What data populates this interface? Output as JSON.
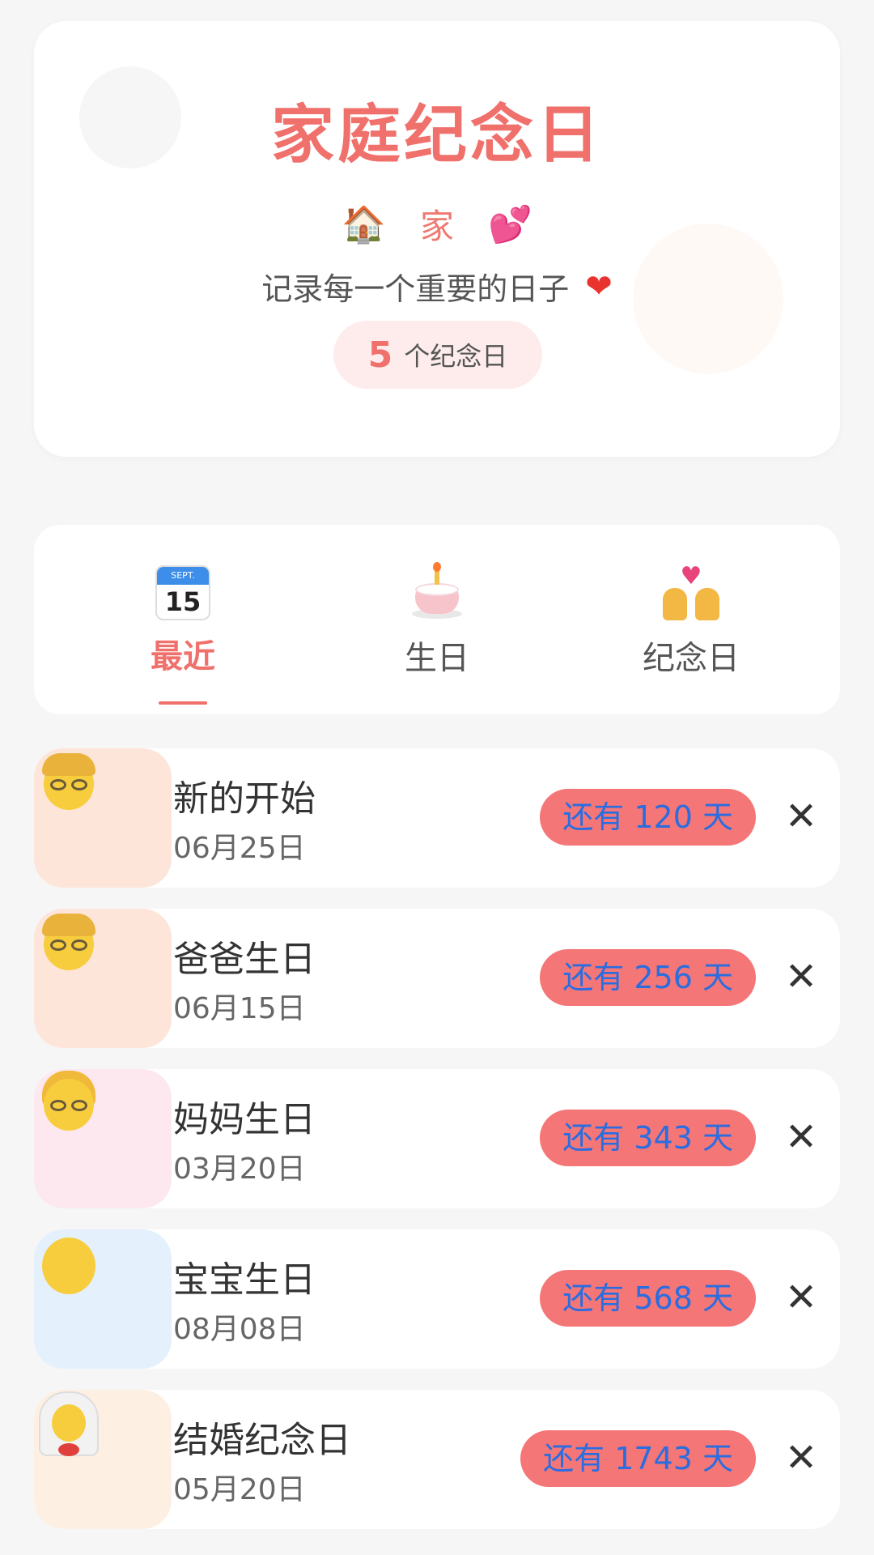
{
  "header": {
    "title": "家庭纪念日",
    "family_name": "家",
    "house_emoji": "🏠",
    "hearts_emoji": "💕",
    "slogan": "记录每一个重要的日子",
    "slogan_heart": "❤",
    "count_value": "5",
    "count_label": "个纪念日"
  },
  "tabs": [
    {
      "label": "最近",
      "icon": "calendar-icon",
      "active": true,
      "calendar_top": "SEPT.",
      "calendar_day": "15"
    },
    {
      "label": "生日",
      "icon": "cake-icon",
      "active": false
    },
    {
      "label": "纪念日",
      "icon": "couple-heart-icon",
      "active": false
    }
  ],
  "items": [
    {
      "title": "新的开始",
      "date": "06月25日",
      "days": "还有 120 天",
      "avatar": "old-man-face-icon",
      "avatar_bg": "#fde5da",
      "delete": "✕"
    },
    {
      "title": "爸爸生日",
      "date": "06月15日",
      "days": "还有 256 天",
      "avatar": "old-man-face-icon",
      "avatar_bg": "#fde5da",
      "delete": "✕"
    },
    {
      "title": "妈妈生日",
      "date": "03月20日",
      "days": "还有 343 天",
      "avatar": "old-woman-face-icon",
      "avatar_bg": "#fde8ef",
      "delete": "✕"
    },
    {
      "title": "宝宝生日",
      "date": "08月08日",
      "days": "还有 568 天",
      "avatar": "baby-face-icon",
      "avatar_bg": "#e4f1fd",
      "delete": "✕"
    },
    {
      "title": "结婚纪念日",
      "date": "05月20日",
      "days": "还有 1743 天",
      "avatar": "bride-face-icon",
      "avatar_bg": "#fdf0e3",
      "delete": "✕"
    }
  ],
  "colors": {
    "accent": "#f0706c",
    "pill": "#f47677",
    "pill_text": "#2a6de0",
    "background": "#f6f6f6"
  }
}
